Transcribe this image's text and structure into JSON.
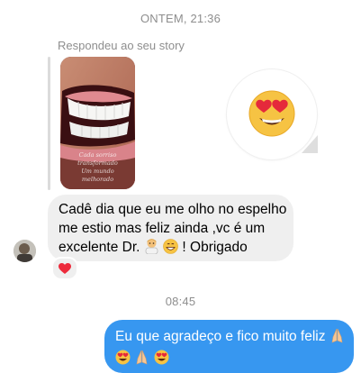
{
  "thread": {
    "timestamp_top": "ONTEM, 21:36",
    "timestamp_bottom": "08:45"
  },
  "story_reply": {
    "label": "Respondeu ao seu story",
    "caption_line1": "Cada sorriso transformado",
    "caption_line2": "Um mundo melhorado",
    "reaction_icon": "heart-eyes-emoji"
  },
  "incoming_message": {
    "text_part1": "Cadê dia que eu me olho no espelho me estio mas feliz ainda ,vc é um excelente Dr. ",
    "text_part2": " ",
    "text_part3": " ! Obrigado",
    "emojis": [
      "doctor-emoji",
      "grin-emoji"
    ],
    "reaction": "red-heart-emoji"
  },
  "outgoing_message": {
    "text": "Eu que agradeço e fico muito feliz ",
    "emojis": [
      "pray-emoji",
      "heart-eyes-emoji",
      "pray-emoji",
      "heart-eyes-emoji"
    ]
  },
  "colors": {
    "outgoing_bubble": "#3797f0",
    "incoming_bubble": "#efefef",
    "meta_text": "#8e8e8e"
  }
}
